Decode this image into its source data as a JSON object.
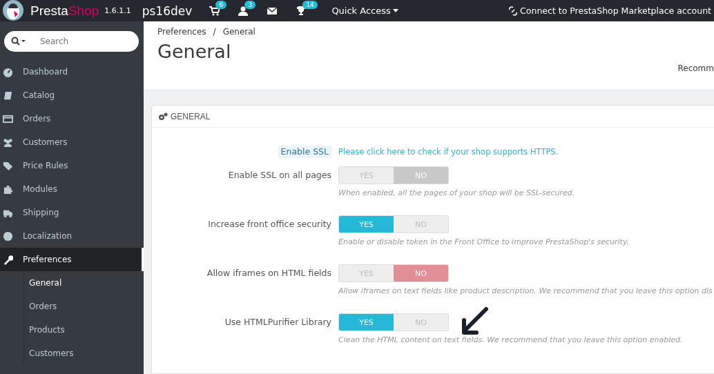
{
  "header": {
    "brand_parts": [
      "Presta",
      "Shop"
    ],
    "version": "1.6.1.1",
    "shop_name": "ps16dev",
    "notifications": [
      {
        "kind": "cart",
        "count": "6"
      },
      {
        "kind": "user",
        "count": "3"
      },
      {
        "kind": "mail"
      },
      {
        "kind": "trophy",
        "count": "14"
      }
    ],
    "quick_access": "Quick Access",
    "marketplace": "Connect to PrestaShop Marketplace account"
  },
  "sidebar": {
    "search": {
      "placeholder": "Search"
    },
    "items": [
      {
        "label": "Dashboard",
        "selected": false
      },
      {
        "label": "Catalog",
        "selected": false
      },
      {
        "label": "Orders",
        "selected": false
      },
      {
        "label": "Customers",
        "selected": false
      },
      {
        "label": "Price Rules",
        "selected": false
      },
      {
        "label": "Modules",
        "selected": false
      },
      {
        "label": "Shipping",
        "selected": false
      },
      {
        "label": "Localization",
        "selected": false
      },
      {
        "label": "Preferences",
        "selected": true,
        "children": [
          {
            "label": "General",
            "selected": true
          },
          {
            "label": "Orders",
            "selected": false
          },
          {
            "label": "Products",
            "selected": false
          },
          {
            "label": "Customers",
            "selected": false
          }
        ]
      }
    ]
  },
  "breadcrumb": {
    "items": [
      "Preferences",
      "General"
    ],
    "separator": "/"
  },
  "page_title": "General",
  "toolbar_text": "Recomm",
  "panel": {
    "title": "GENERAL",
    "ssl": {
      "label": "Enable SSL",
      "link": "Please click here to check if your shop supports HTTPS."
    },
    "rows": [
      {
        "label": "Enable SSL on all pages",
        "disabled": true,
        "options": [
          {
            "label": "YES",
            "selected": false
          },
          {
            "label": "NO",
            "selected": true
          }
        ],
        "help": "When enabled, all the pages of your shop will be SSL-secured."
      },
      {
        "label": "Increase front office security",
        "disabled": false,
        "options": [
          {
            "label": "YES",
            "selected": true
          },
          {
            "label": "NO",
            "selected": false
          }
        ],
        "help": "Enable or disable token in the Front Office to improve PrestaShop's security."
      },
      {
        "label": "Allow iframes on HTML fields",
        "disabled": false,
        "options": [
          {
            "label": "YES",
            "selected": false
          },
          {
            "label": "NO",
            "selected": true
          }
        ],
        "help": "Allow iframes on text fields like product description. We recommend that you leave this option dis"
      },
      {
        "label": "Use HTMLPurifier Library",
        "disabled": false,
        "options": [
          {
            "label": "YES",
            "selected": true
          },
          {
            "label": "NO",
            "selected": false
          }
        ],
        "help": "Clean the HTML content on text fields. We recommend that you leave this option enabled."
      }
    ]
  }
}
